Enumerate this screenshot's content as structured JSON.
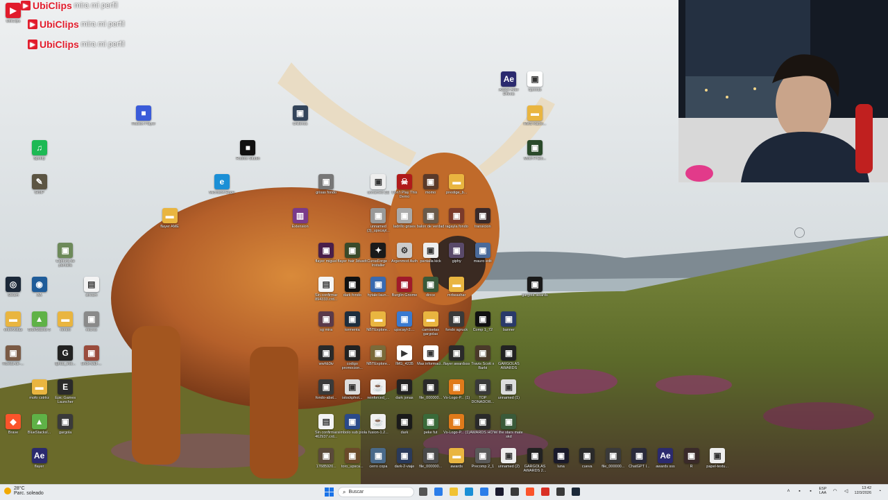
{
  "overlay": {
    "brand": "UbiClips",
    "subtitle": "mira mi perfil",
    "colors": {
      "brand_red": "#e11b2b"
    }
  },
  "desktop_icons": [
    {
      "label": "UbiClips",
      "icon": "ubiclips",
      "color": "#e11b2b",
      "col": 0,
      "row": 0
    },
    {
      "label": "Steam",
      "icon": "steam",
      "color": "#1b2838",
      "col": 0,
      "row": 8
    },
    {
      "label": "entrevistas",
      "icon": "folder",
      "color": "#e9b540",
      "col": 0,
      "row": 9
    },
    {
      "label": "Rueda-de-...",
      "icon": "image",
      "color": "#7a5a45",
      "col": 0,
      "row": 10
    },
    {
      "label": "Brave",
      "icon": "brave",
      "color": "#fb542b",
      "col": 0,
      "row": 12
    },
    {
      "label": "Spotify",
      "icon": "spotify",
      "color": "#1db954",
      "col": 1,
      "row": 4
    },
    {
      "label": "GIMP",
      "icon": "gimp",
      "color": "#5c5543",
      "col": 1,
      "row": 5
    },
    {
      "label": "AA",
      "icon": "app",
      "color": "#1f5c99",
      "col": 1,
      "row": 8
    },
    {
      "label": "BlueStacks 5",
      "icon": "bluestacks",
      "color": "#5fb247",
      "col": 1,
      "row": 9
    },
    {
      "label": "mofo cstrtrz",
      "icon": "folder",
      "color": "#e9b540",
      "col": 1,
      "row": 11
    },
    {
      "label": "BlueStacksl...",
      "icon": "bluestacks",
      "color": "#5fb247",
      "col": 1,
      "row": 12
    },
    {
      "label": "flayer",
      "icon": "after-effects",
      "color": "#2b2a6e",
      "col": 1,
      "row": 13
    },
    {
      "label": "Captura de pantalla",
      "icon": "image",
      "color": "#6d8a5a",
      "col": 2,
      "row": 7
    },
    {
      "label": "remini",
      "icon": "folder",
      "color": "#e9b540",
      "col": 2,
      "row": 9
    },
    {
      "label": "lghub_inst...",
      "icon": "logitech",
      "color": "#222222",
      "col": 2,
      "row": 10
    },
    {
      "label": "Epic Games Launcher",
      "icon": "epic",
      "color": "#2a2a2a",
      "col": 2,
      "row": 11
    },
    {
      "label": "gargola",
      "icon": "image",
      "color": "#3a3a3a",
      "col": 2,
      "row": 12
    },
    {
      "label": "stream",
      "icon": "file",
      "color": "#f4f4f4",
      "col": 3,
      "row": 8
    },
    {
      "label": "micros",
      "icon": "image",
      "color": "#8a8a8a",
      "col": 3,
      "row": 9
    },
    {
      "label": "brick-wall-...",
      "icon": "image",
      "color": "#9a4b3c",
      "col": 3,
      "row": 10
    },
    {
      "label": "Roblox Player",
      "icon": "roblox",
      "color": "#3a5bd9",
      "col": 5,
      "row": 3
    },
    {
      "label": "flayer AME",
      "icon": "folder",
      "color": "#e9b540",
      "col": 6,
      "row": 6
    },
    {
      "label": "Microsoft Edge",
      "icon": "edge",
      "color": "#1b8fd6",
      "col": 8,
      "row": 5
    },
    {
      "label": "Roblox Studio",
      "icon": "roblox",
      "color": "#111111",
      "col": 9,
      "row": 4
    },
    {
      "label": "Chilenos",
      "icon": "image",
      "color": "#33445a",
      "col": 11,
      "row": 3
    },
    {
      "label": "Extension",
      "icon": "winrar",
      "color": "#7a3a8a",
      "col": 11,
      "row": 6
    },
    {
      "label": "grisas fondo",
      "icon": "image",
      "color": "#777777",
      "col": 12,
      "row": 5
    },
    {
      "label": "flayer miguel",
      "icon": "image",
      "color": "#4a1f4a",
      "col": 12,
      "row": 7
    },
    {
      "label": "Sin confirmar 894333.crd...",
      "icon": "file",
      "color": "#f4f4f4",
      "col": 12,
      "row": 8
    },
    {
      "label": "sg mira",
      "icon": "image",
      "color": "#5a3a4a",
      "col": 12,
      "row": 9
    },
    {
      "label": "wwhb3iv",
      "icon": "image",
      "color": "#2a2a2a",
      "col": 12,
      "row": 10
    },
    {
      "label": "fondo-abst...",
      "icon": "image",
      "color": "#3a3a3a",
      "col": 12,
      "row": 11
    },
    {
      "label": "Sin confirmar 462937.crd...",
      "icon": "file",
      "color": "#f4f4f4",
      "col": 12,
      "row": 12
    },
    {
      "label": "17685920...",
      "icon": "image",
      "color": "#5a4a3a",
      "col": 12,
      "row": 13
    },
    {
      "label": "flayer hair 3dusdt",
      "icon": "image",
      "color": "#3a4a2a",
      "col": 13,
      "row": 7
    },
    {
      "label": "dark fondo",
      "icon": "image",
      "color": "#111111",
      "col": 13,
      "row": 8
    },
    {
      "label": "tormenta",
      "icon": "image",
      "color": "#1e2e3e",
      "col": 13,
      "row": 9
    },
    {
      "label": "codigo promocion...",
      "icon": "image",
      "color": "#222222",
      "col": 13,
      "row": 10
    },
    {
      "label": "istockphot...",
      "icon": "image",
      "color": "#dddddd",
      "col": 13,
      "row": 11
    },
    {
      "label": "simbolo sub piola",
      "icon": "image",
      "color": "#2a4a8a",
      "col": 13,
      "row": 12
    },
    {
      "label": "toro_upsca...",
      "icon": "image",
      "color": "#6a4a2a",
      "col": 13,
      "row": 13
    },
    {
      "label": "unnamed (3)",
      "icon": "image",
      "color": "#eeeeee",
      "col": 14,
      "row": 5
    },
    {
      "label": "unnamed (3)_upscayl...",
      "icon": "image",
      "color": "#999999",
      "col": 14,
      "row": 6
    },
    {
      "label": "CurseForge - Installer",
      "icon": "curseforge",
      "color": "#1a1a1a",
      "col": 14,
      "row": 7
    },
    {
      "label": "hytale-laun...",
      "icon": "image",
      "color": "#3a6ab0",
      "col": 14,
      "row": 8
    },
    {
      "label": "NBTExplore...",
      "icon": "folder",
      "color": "#e9b540",
      "col": 14,
      "row": 9
    },
    {
      "label": "NBTExplore...",
      "icon": "image",
      "color": "#7a6a3a",
      "col": 14,
      "row": 10
    },
    {
      "label": "reinforced_...",
      "icon": "java",
      "color": "#f0f0f0",
      "col": 14,
      "row": 11
    },
    {
      "label": "fusion-1.2...",
      "icon": "java",
      "color": "#f0f0f0",
      "col": 14,
      "row": 12
    },
    {
      "label": "cerro copa",
      "icon": "image",
      "color": "#4a6a8a",
      "col": 14,
      "row": 13
    },
    {
      "label": "Don't Play This Demo",
      "icon": "game",
      "color": "#b01a1a",
      "col": 15,
      "row": 5
    },
    {
      "label": "ladrillo grises",
      "icon": "image",
      "color": "#aaaaaa",
      "col": 15,
      "row": 6
    },
    {
      "label": "Argenmod Auth",
      "icon": "gear",
      "color": "#cccccc",
      "col": 15,
      "row": 7
    },
    {
      "label": "Burglin Gnome",
      "icon": "image",
      "color": "#a01a2a",
      "col": 15,
      "row": 8
    },
    {
      "label": "upscayl-2....",
      "icon": "image",
      "color": "#3a7ad0",
      "col": 15,
      "row": 9
    },
    {
      "label": "IMG_4235",
      "icon": "video",
      "color": "#ffffff",
      "col": 15,
      "row": 10
    },
    {
      "label": "dark jonas",
      "icon": "image",
      "color": "#222222",
      "col": 15,
      "row": 11
    },
    {
      "label": "dark",
      "icon": "image",
      "color": "#1a1a1a",
      "col": 15,
      "row": 12
    },
    {
      "label": "dark-2-viaje",
      "icon": "image",
      "color": "#2a3a5a",
      "col": 15,
      "row": 13
    },
    {
      "label": "momo",
      "icon": "image",
      "color": "#5a3a2a",
      "col": 16,
      "row": 5
    },
    {
      "label": "balon de verdad",
      "icon": "image",
      "color": "#6a5a4a",
      "col": 16,
      "row": 6
    },
    {
      "label": "pantalla kick",
      "icon": "image",
      "color": "#eeeeee",
      "col": 16,
      "row": 7
    },
    {
      "label": "dince",
      "icon": "image",
      "color": "#3a5a3a",
      "col": 16,
      "row": 8
    },
    {
      "label": "camisetas gargolas",
      "icon": "folder",
      "color": "#e9b540",
      "col": 16,
      "row": 9
    },
    {
      "label": "Mas informaci...",
      "icon": "image",
      "color": "#ffffff",
      "col": 16,
      "row": 10
    },
    {
      "label": "file_000000...",
      "icon": "image",
      "color": "#2a2a2a",
      "col": 16,
      "row": 11
    },
    {
      "label": "peke fut",
      "icon": "image",
      "color": "#3a6a3a",
      "col": 16,
      "row": 12
    },
    {
      "label": "file_000000...",
      "icon": "image",
      "color": "#4a4a4a",
      "col": 16,
      "row": 13
    },
    {
      "label": "prestige_b...",
      "icon": "folder",
      "color": "#e9b540",
      "col": 17,
      "row": 5
    },
    {
      "label": "ragayla fondo",
      "icon": "image",
      "color": "#7a3a2a",
      "col": 17,
      "row": 6
    },
    {
      "label": "giphy",
      "icon": "image",
      "color": "#5a4a6a",
      "col": 17,
      "row": 7
    },
    {
      "label": "mrbeashar",
      "icon": "folder",
      "color": "#e9b540",
      "col": 17,
      "row": 8
    },
    {
      "label": "fondo agruck",
      "icon": "image",
      "color": "#3a3a3a",
      "col": 17,
      "row": 9
    },
    {
      "label": "flayer awardsss",
      "icon": "image",
      "color": "#2a2a2a",
      "col": 17,
      "row": 10
    },
    {
      "label": "Vs-Logo-P... (1)",
      "icon": "image",
      "color": "#e07a1a",
      "col": 17,
      "row": 11
    },
    {
      "label": "Vs-Logo-P... (1)",
      "icon": "image",
      "color": "#e07a1a",
      "col": 17,
      "row": 12
    },
    {
      "label": "awards",
      "icon": "folder",
      "color": "#e9b540",
      "col": 17,
      "row": 13
    },
    {
      "label": "transicion",
      "icon": "image",
      "color": "#3a2a2a",
      "col": 18,
      "row": 6
    },
    {
      "label": "mauro edit",
      "icon": "image",
      "color": "#4a6a9a",
      "col": 18,
      "row": 7
    },
    {
      "label": "Comp 1_72",
      "icon": "image",
      "color": "#111111",
      "col": 18,
      "row": 9
    },
    {
      "label": "Travis Scott x Barbi",
      "icon": "image",
      "color": "#4a3a2a",
      "col": 18,
      "row": 10
    },
    {
      "label": "TOP DONADOR...",
      "icon": "image",
      "color": "#3a3a3a",
      "col": 18,
      "row": 11
    },
    {
      "label": "AWARDS HOY",
      "icon": "image",
      "color": "#2a2a2a",
      "col": 18,
      "row": 12
    },
    {
      "label": "Precomp 2_1",
      "icon": "image",
      "color": "#5a5a5a",
      "col": 18,
      "row": 13
    },
    {
      "label": "GARGOLAS AWARDS",
      "icon": "image",
      "color": "#222222",
      "col": 19,
      "row": 10
    },
    {
      "label": "unnamed (1)",
      "icon": "image",
      "color": "#dddddd",
      "col": 19,
      "row": 11
    },
    {
      "label": "el the stars mate skd",
      "icon": "image",
      "color": "#3a5a3a",
      "col": 19,
      "row": 12
    },
    {
      "label": "unnamed (2)",
      "icon": "image",
      "color": "#eeeeee",
      "col": 19,
      "row": 13
    },
    {
      "label": "banner",
      "icon": "image",
      "color": "#2a3a6a",
      "col": 19,
      "row": 9
    },
    {
      "label": "gargola awards",
      "icon": "image",
      "color": "#1a1a1a",
      "col": 20,
      "row": 8
    },
    {
      "label": "GARGOLAS AWARDS 2...",
      "icon": "image",
      "color": "#222222",
      "col": 20,
      "row": 13
    },
    {
      "label": "luna",
      "icon": "image",
      "color": "#1a1a2a",
      "col": 21,
      "row": 13
    },
    {
      "label": "cueva",
      "icon": "image",
      "color": "#2a2a2a",
      "col": 22,
      "row": 13
    },
    {
      "label": "file_000000...",
      "icon": "image",
      "color": "#3a3a3a",
      "col": 23,
      "row": 13
    },
    {
      "label": "ChatGPT I...",
      "icon": "image",
      "color": "#2a2a3a",
      "col": 24,
      "row": 13
    },
    {
      "label": "awards sss",
      "icon": "after-effects",
      "color": "#2b2a6e",
      "col": 25,
      "row": 13
    },
    {
      "label": "R",
      "icon": "image",
      "color": "#3a2a2a",
      "col": 26,
      "row": 13
    },
    {
      "label": "papel-textu...",
      "icon": "image",
      "color": "#eeeeee",
      "col": 27,
      "row": 13
    },
    {
      "label": "HMS Racer...",
      "icon": "folder",
      "color": "#e9b540",
      "col": 20,
      "row": 3
    },
    {
      "label": "Moth Fl Exi...",
      "icon": "image",
      "color": "#2a4a2a",
      "col": 20,
      "row": 4
    },
    {
      "label": "Adobe After Effects",
      "icon": "after-effects",
      "color": "#2b2a6e",
      "col": 19,
      "row": 2
    },
    {
      "label": "Speedo",
      "icon": "image",
      "color": "#ffffff",
      "col": 20,
      "row": 2
    }
  ],
  "taskbar": {
    "weather_temp": "28°C",
    "weather_desc": "Parc. soleado",
    "search_placeholder": "Buscar",
    "lang_top": "ESP",
    "lang_bottom": "LAA",
    "time": "13:42",
    "date": "12/3/2026",
    "apps": [
      {
        "name": "taskview-icon",
        "color": "#555555"
      },
      {
        "name": "copilot-icon",
        "color": "#2b7de9"
      },
      {
        "name": "file-explorer-icon",
        "color": "#f1c232"
      },
      {
        "name": "edge-icon",
        "color": "#1b8fd6"
      },
      {
        "name": "store-icon",
        "color": "#2b7de9"
      },
      {
        "name": "fe-app-icon",
        "color": "#1a1a2e"
      },
      {
        "name": "arm-app-icon",
        "color": "#3a3a3a"
      },
      {
        "name": "brave-icon",
        "color": "#fb542b"
      },
      {
        "name": "media-app-icon",
        "color": "#d93025"
      },
      {
        "name": "capture-app-icon",
        "color": "#3a3a3a"
      },
      {
        "name": "steam-icon",
        "color": "#1b2838"
      }
    ]
  },
  "webcam": {
    "label": "webcam-feed"
  }
}
